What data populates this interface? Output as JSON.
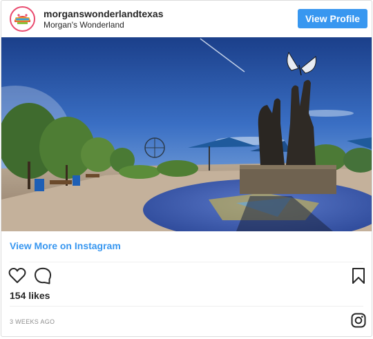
{
  "post": {
    "username": "morganswonderlandtexas",
    "full_name": "Morgan's Wonderland",
    "view_profile_label": "View Profile",
    "view_more_label": "View More on Instagram",
    "likes_label": "154 likes",
    "timestamp": "3 WEEKS AGO"
  },
  "icons": {
    "like": "heart-icon",
    "comment": "comment-icon",
    "save": "bookmark-icon",
    "instagram": "instagram-logo-icon"
  },
  "colors": {
    "button_blue": "#3897f0",
    "text": "#262626",
    "muted": "#8e8e8e"
  }
}
